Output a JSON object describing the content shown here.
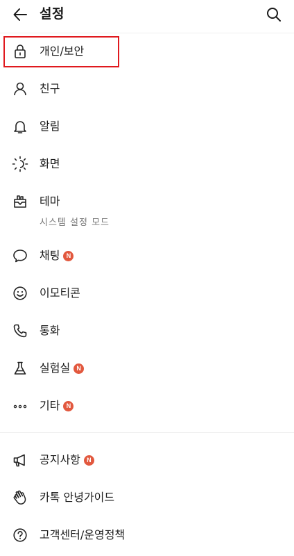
{
  "header": {
    "title": "설정",
    "back_icon": "arrow-left-icon",
    "search_icon": "search-icon"
  },
  "menu_primary": [
    {
      "label": "개인/보안",
      "icon": "lock-icon",
      "badge": ""
    },
    {
      "label": "친구",
      "icon": "person-icon",
      "badge": ""
    },
    {
      "label": "알림",
      "icon": "bell-icon",
      "badge": ""
    },
    {
      "label": "화면",
      "icon": "brightness-icon",
      "badge": ""
    },
    {
      "label": "테마",
      "icon": "theme-icon",
      "sub": "시스템 설정 모드",
      "badge": ""
    },
    {
      "label": "채팅",
      "icon": "chat-bubble-icon",
      "badge": "N"
    },
    {
      "label": "이모티콘",
      "icon": "smiley-icon",
      "badge": ""
    },
    {
      "label": "통화",
      "icon": "phone-icon",
      "badge": ""
    },
    {
      "label": "실험실",
      "icon": "flask-icon",
      "badge": "N"
    },
    {
      "label": "기타",
      "icon": "more-icon",
      "badge": "N"
    }
  ],
  "menu_secondary": [
    {
      "label": "공지사항",
      "icon": "megaphone-icon",
      "badge": "N"
    },
    {
      "label": "카톡 안녕가이드",
      "icon": "hand-icon",
      "badge": ""
    },
    {
      "label": "고객센터/운영정책",
      "icon": "help-icon",
      "badge": ""
    }
  ],
  "colors": {
    "highlight": "#e0191e",
    "badge": "#e2583e"
  }
}
